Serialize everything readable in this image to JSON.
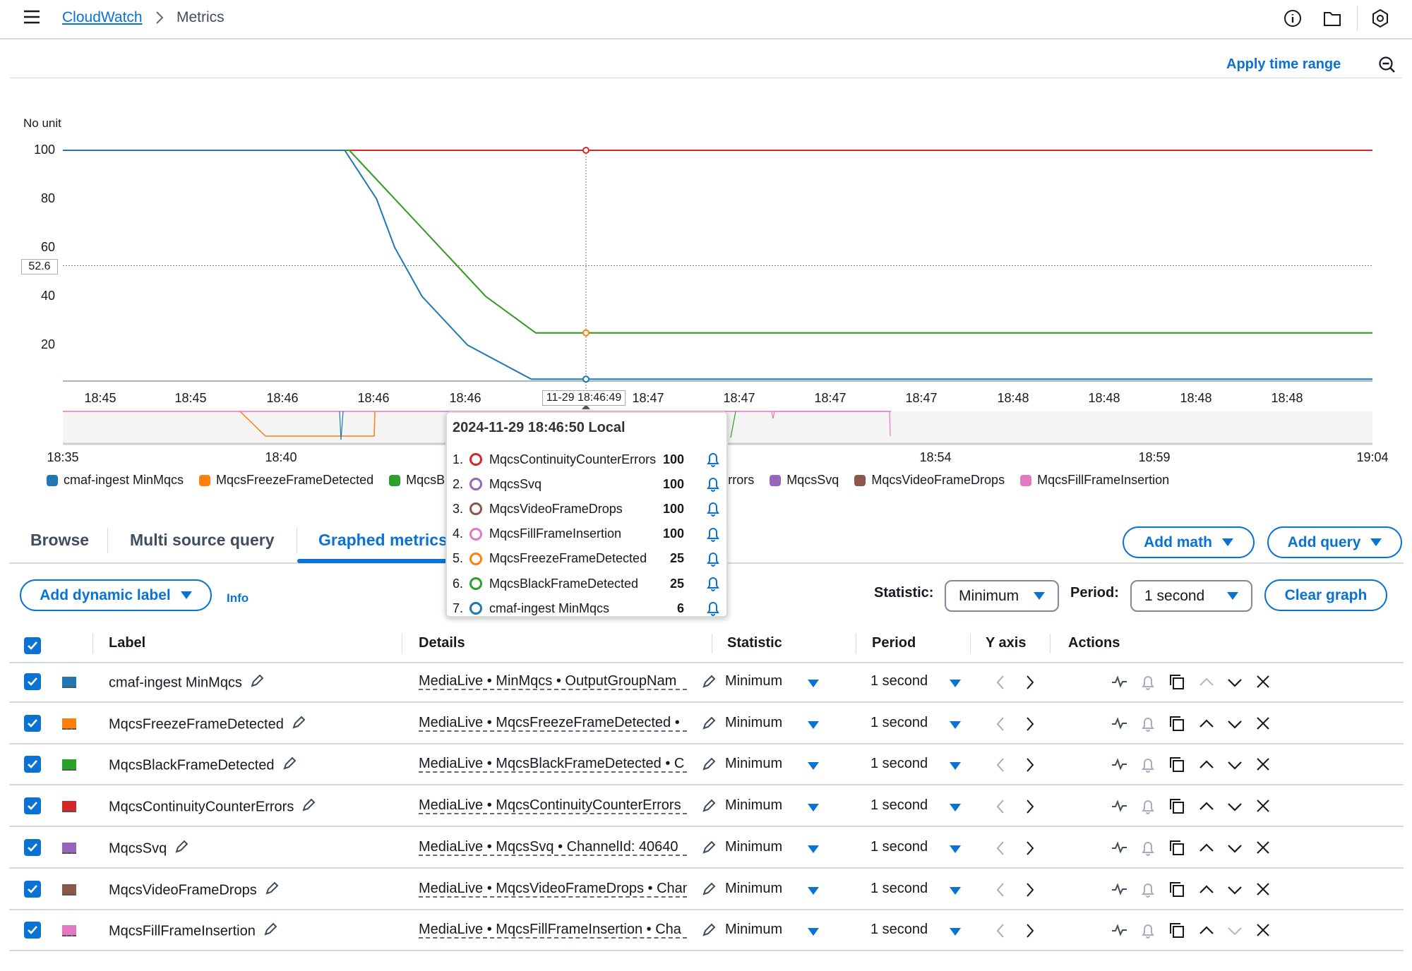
{
  "header": {
    "breadcrumb": [
      "CloudWatch",
      "Metrics"
    ],
    "icons": [
      "menu-icon",
      "info-icon",
      "folder-icon",
      "settings-icon"
    ]
  },
  "toolbar": {
    "apply_time_range": "Apply time range"
  },
  "chart_data": {
    "type": "line",
    "ylabel": "No unit",
    "ylim": [
      0,
      100
    ],
    "yticks": [
      "100",
      "80",
      "60",
      "40",
      "20"
    ],
    "xticks": [
      "18:45",
      "18:45",
      "18:46",
      "18:46",
      "18:46",
      "18:47",
      "18:47",
      "18:47",
      "18:47",
      "18:48",
      "18:48",
      "18:48",
      "18:48"
    ],
    "xrange": [
      "18:44:54",
      "18:49:42"
    ],
    "cursor_label": "11-29 18:46:49",
    "hover_value_label": "52.6",
    "series": [
      {
        "name": "cmaf-ingest MinMqcs",
        "color": "#1f77b4",
        "points": [
          [
            "18:44:54",
            100
          ],
          [
            "18:45:56",
            100
          ],
          [
            "18:46:03",
            80
          ],
          [
            "18:46:07",
            60
          ],
          [
            "18:46:13",
            40
          ],
          [
            "18:46:23",
            20
          ],
          [
            "18:46:37",
            6
          ],
          [
            "18:49:42",
            6
          ]
        ]
      },
      {
        "name": "MqcsFreezeFrameDetected",
        "color": "#ff7f0e",
        "points": [
          [
            "18:44:54",
            100
          ],
          [
            "18:45:57",
            100
          ],
          [
            "18:46:07",
            80
          ],
          [
            "18:46:17",
            60
          ],
          [
            "18:46:27",
            40
          ],
          [
            "18:46:38",
            25
          ],
          [
            "18:49:42",
            25
          ]
        ]
      },
      {
        "name": "MqcsBlackFrameDetected",
        "color": "#2ca02c",
        "points": [
          [
            "18:44:54",
            100
          ],
          [
            "18:45:57",
            100
          ],
          [
            "18:46:07",
            80
          ],
          [
            "18:46:17",
            60
          ],
          [
            "18:46:27",
            40
          ],
          [
            "18:46:38",
            25
          ],
          [
            "18:49:42",
            25
          ]
        ]
      },
      {
        "name": "MqcsContinuityCounterErrors",
        "color": "#d62728",
        "points": [
          [
            "18:44:54",
            100
          ],
          [
            "18:49:42",
            100
          ]
        ]
      },
      {
        "name": "MqcsSvq",
        "color": "#9467bd",
        "points": [
          [
            "18:44:54",
            100
          ],
          [
            "18:49:42",
            100
          ]
        ]
      },
      {
        "name": "MqcsVideoFrameDrops",
        "color": "#8c564b",
        "points": [
          [
            "18:44:54",
            100
          ],
          [
            "18:49:42",
            100
          ]
        ]
      },
      {
        "name": "MqcsFillFrameInsertion",
        "color": "#e377c2",
        "points": [
          [
            "18:44:54",
            100
          ],
          [
            "18:49:42",
            100
          ]
        ]
      }
    ],
    "navigator_ticks": [
      "18:35",
      "18:40",
      "18:54",
      "18:59",
      "19:04"
    ]
  },
  "tooltip": {
    "title": "2024-11-29 18:46:50 Local",
    "items": [
      {
        "n": "1.",
        "name": "MqcsContinuityCounterErrors",
        "value": "100",
        "color": "#d62728"
      },
      {
        "n": "2.",
        "name": "MqcsSvq",
        "value": "100",
        "color": "#9467bd"
      },
      {
        "n": "3.",
        "name": "MqcsVideoFrameDrops",
        "value": "100",
        "color": "#8c564b"
      },
      {
        "n": "4.",
        "name": "MqcsFillFrameInsertion",
        "value": "100",
        "color": "#e377c2"
      },
      {
        "n": "5.",
        "name": "MqcsFreezeFrameDetected",
        "value": "25",
        "color": "#ff7f0e"
      },
      {
        "n": "6.",
        "name": "MqcsBlackFrameDetected",
        "value": "25",
        "color": "#2ca02c"
      },
      {
        "n": "7.",
        "name": "cmaf-ingest MinMqcs",
        "value": "6",
        "color": "#1f77b4"
      }
    ]
  },
  "tabs": [
    "Browse",
    "Multi source query",
    "Graphed metrics"
  ],
  "active_tab": "Graphed metrics",
  "buttons": {
    "add_math": "Add math",
    "add_query": "Add query",
    "add_dynamic_label": "Add dynamic label",
    "info": "Info",
    "clear_graph": "Clear graph"
  },
  "controls": {
    "statistic_label": "Statistic:",
    "statistic_value": "Minimum",
    "period_label": "Period:",
    "period_value": "1 second"
  },
  "table": {
    "headers": [
      "Label",
      "Details",
      "Statistic",
      "Period",
      "Y axis",
      "Actions"
    ],
    "rows": [
      {
        "label": "cmaf-ingest MinMqcs",
        "color": "#1f77b4",
        "details": "MediaLive • MinMqcs • OutputGroupNam",
        "statistic": "Minimum",
        "period": "1 second",
        "checked": true,
        "up_enabled": false,
        "down_enabled": true
      },
      {
        "label": "MqcsFreezeFrameDetected",
        "color": "#ff7f0e",
        "details": "MediaLive • MqcsFreezeFrameDetected • ",
        "statistic": "Minimum",
        "period": "1 second",
        "checked": true,
        "up_enabled": true,
        "down_enabled": true
      },
      {
        "label": "MqcsBlackFrameDetected",
        "color": "#2ca02c",
        "details": "MediaLive • MqcsBlackFrameDetected • C",
        "statistic": "Minimum",
        "period": "1 second",
        "checked": true,
        "up_enabled": true,
        "down_enabled": true
      },
      {
        "label": "MqcsContinuityCounterErrors",
        "color": "#d62728",
        "details": "MediaLive • MqcsContinuityCounterErrors",
        "statistic": "Minimum",
        "period": "1 second",
        "checked": true,
        "up_enabled": true,
        "down_enabled": true
      },
      {
        "label": "MqcsSvq",
        "color": "#9467bd",
        "details": "MediaLive • MqcsSvq • ChannelId: 40640",
        "statistic": "Minimum",
        "period": "1 second",
        "checked": true,
        "up_enabled": true,
        "down_enabled": true
      },
      {
        "label": "MqcsVideoFrameDrops",
        "color": "#8c564b",
        "details": "MediaLive • MqcsVideoFrameDrops • Chan",
        "statistic": "Minimum",
        "period": "1 second",
        "checked": true,
        "up_enabled": true,
        "down_enabled": true
      },
      {
        "label": "MqcsFillFrameInsertion",
        "color": "#e377c2",
        "details": "MediaLive • MqcsFillFrameInsertion • Cha",
        "statistic": "Minimum",
        "period": "1 second",
        "checked": true,
        "up_enabled": true,
        "down_enabled": false
      }
    ]
  }
}
